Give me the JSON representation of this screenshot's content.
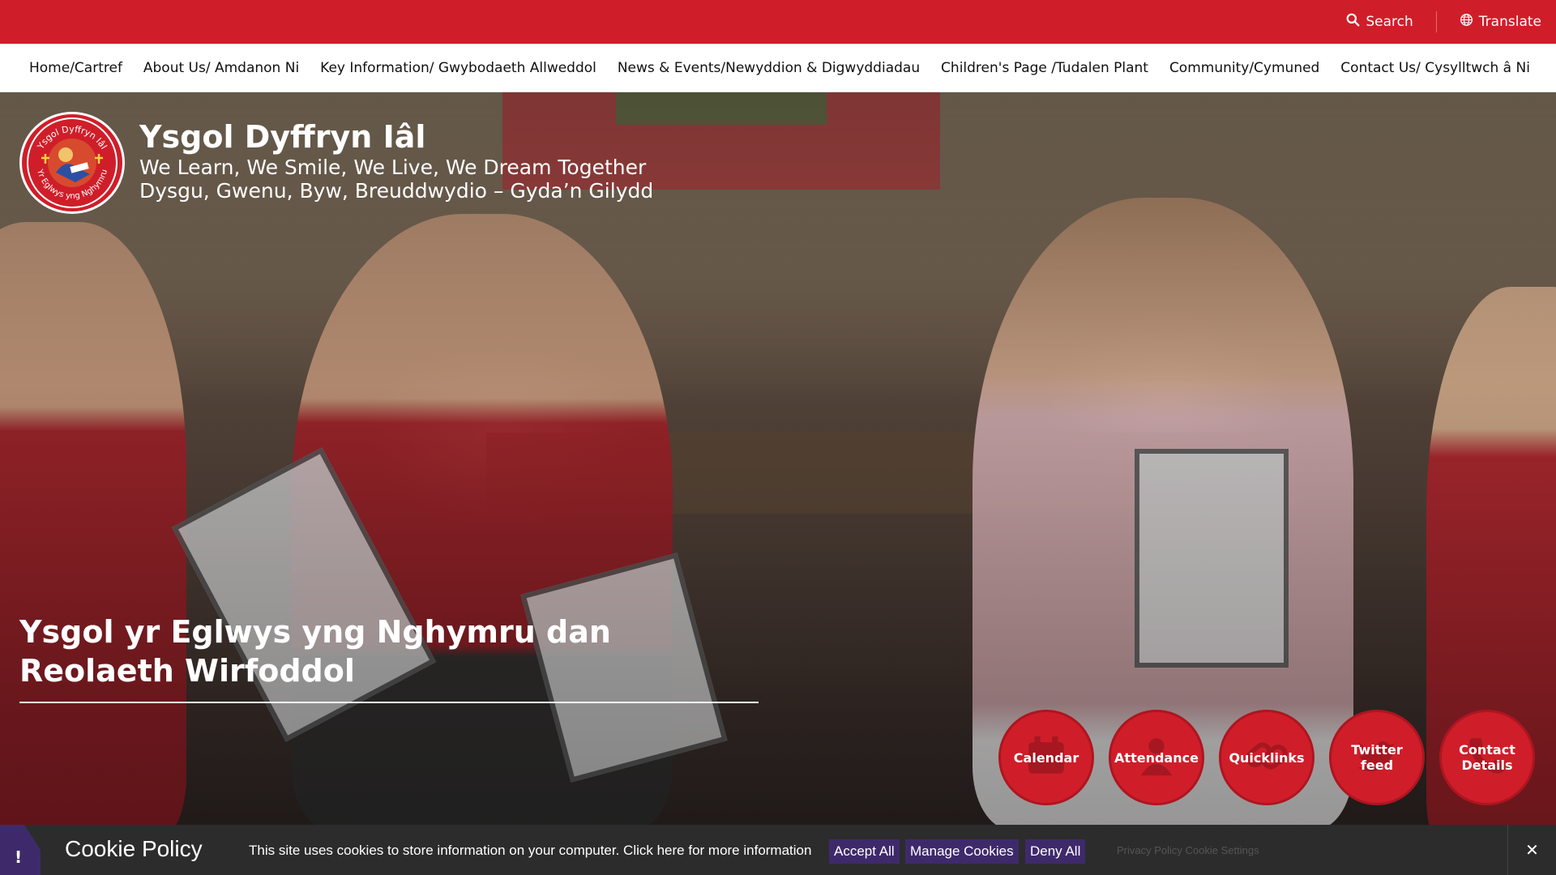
{
  "topbar": {
    "search_label": "Search",
    "translate_label": "Translate",
    "background_color": "#cf1e29"
  },
  "nav": {
    "items": [
      "Home/Cartref",
      "About Us/ Amdanon Ni",
      "Key Information/ Gwybodaeth Allweddol",
      "News & Events/Newyddion & Digwyddiadau",
      "Children's Page /Tudalen Plant",
      "Community/Cymuned",
      "Contact Us/ Cysylltwch â Ni"
    ]
  },
  "brand": {
    "school_name": "Ysgol Dyffryn Iâl",
    "motto_en": "We Learn, We Smile, We Live, We Dream Together",
    "motto_cy": "Dysgu, Gwenu, Byw, Breuddwydio – Gyda’n Gilydd",
    "logo_text_top": "Ysgol Dyffryn Iâl",
    "logo_text_bottom": "Yr Eglwys yng Nghymru"
  },
  "hero": {
    "heading": "Ysgol yr Eglwys yng Nghymru dan Reolaeth Wirfoddol"
  },
  "quicklinks": [
    {
      "label": "Calendar",
      "icon": "calendar-icon"
    },
    {
      "label": "Attendance",
      "icon": "person-icon"
    },
    {
      "label": "Quicklinks",
      "icon": "link-icon"
    },
    {
      "label": "Twitter feed",
      "icon": "twitter-icon"
    },
    {
      "label": "Contact Details",
      "icon": "phone-icon"
    }
  ],
  "cookie": {
    "alert_symbol": "!",
    "title": "Cookie Policy",
    "message": "This site uses cookies to store information on your computer. Click here for more information",
    "accept_all": "Accept All",
    "manage": "Manage Cookies",
    "deny_all": "Deny All",
    "faint_links": "Privacy Policy  Cookie Settings",
    "close_symbol": "✕",
    "accent_color": "#3e2a6b"
  }
}
